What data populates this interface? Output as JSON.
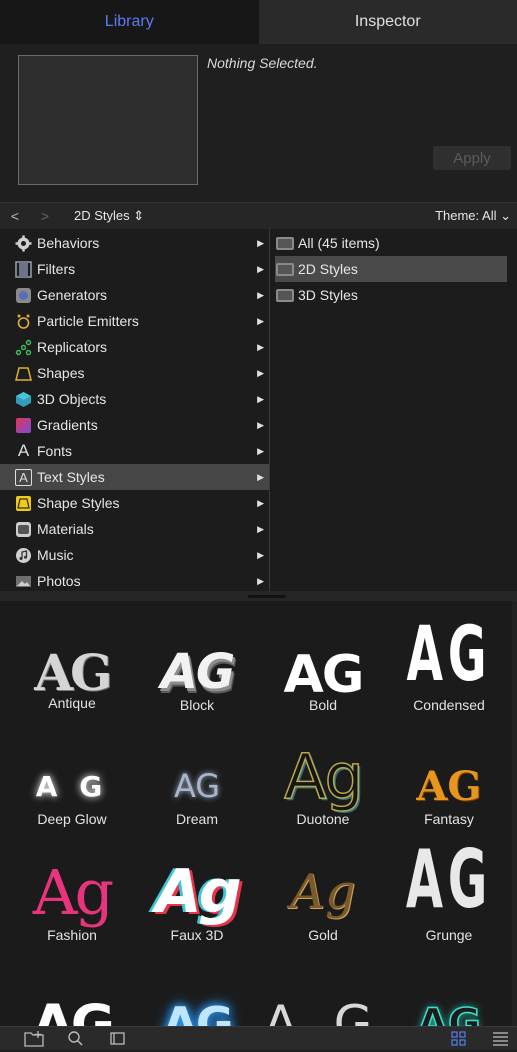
{
  "tabs": {
    "library": "Library",
    "inspector": "Inspector"
  },
  "preview": {
    "status": "Nothing Selected.",
    "apply_label": "Apply"
  },
  "nav": {
    "back": "<",
    "forward": ">",
    "title": "2D Styles ⇕",
    "theme": "Theme: All ⌄"
  },
  "categories": [
    {
      "label": "Behaviors",
      "icon": "gear-icon"
    },
    {
      "label": "Filters",
      "icon": "filmstrip-icon"
    },
    {
      "label": "Generators",
      "icon": "generator-icon"
    },
    {
      "label": "Particle Emitters",
      "icon": "particle-emitter-icon"
    },
    {
      "label": "Replicators",
      "icon": "replicator-icon"
    },
    {
      "label": "Shapes",
      "icon": "shape-icon"
    },
    {
      "label": "3D Objects",
      "icon": "cube-icon"
    },
    {
      "label": "Gradients",
      "icon": "gradient-icon"
    },
    {
      "label": "Fonts",
      "icon": "font-icon"
    },
    {
      "label": "Text Styles",
      "icon": "text-style-icon"
    },
    {
      "label": "Shape Styles",
      "icon": "shape-style-icon"
    },
    {
      "label": "Materials",
      "icon": "material-icon"
    },
    {
      "label": "Music",
      "icon": "music-icon"
    },
    {
      "label": "Photos",
      "icon": "photo-icon"
    }
  ],
  "selected_category": "Text Styles",
  "folders": [
    {
      "label": "All (45 items)"
    },
    {
      "label": "2D Styles"
    },
    {
      "label": "3D Styles"
    }
  ],
  "selected_folder": "2D Styles",
  "styles": [
    {
      "name": "Antique",
      "sample": "AG"
    },
    {
      "name": "Block",
      "sample": "AG"
    },
    {
      "name": "Bold",
      "sample": "AG"
    },
    {
      "name": "Condensed",
      "sample": "AG"
    },
    {
      "name": "Deep Glow",
      "sample": "A G"
    },
    {
      "name": "Dream",
      "sample": "AG"
    },
    {
      "name": "Duotone",
      "sample": "Ag"
    },
    {
      "name": "Fantasy",
      "sample": "AG"
    },
    {
      "name": "Fashion",
      "sample": "Ag"
    },
    {
      "name": "Faux 3D",
      "sample": "Ag"
    },
    {
      "name": "Gold",
      "sample": "Ag"
    },
    {
      "name": "Grunge",
      "sample": "AG"
    },
    {
      "name": "",
      "sample": "AG"
    },
    {
      "name": "",
      "sample": "AG"
    },
    {
      "name": "",
      "sample": "A G"
    },
    {
      "name": "",
      "sample": "AG"
    }
  ],
  "bottom_bar": {
    "left_icons": [
      "new-folder-icon",
      "search-icon",
      "preview-icon"
    ],
    "right_icons": [
      "grid-view-icon",
      "list-view-icon"
    ]
  },
  "colors": {
    "accent": "#5a7cf0"
  }
}
